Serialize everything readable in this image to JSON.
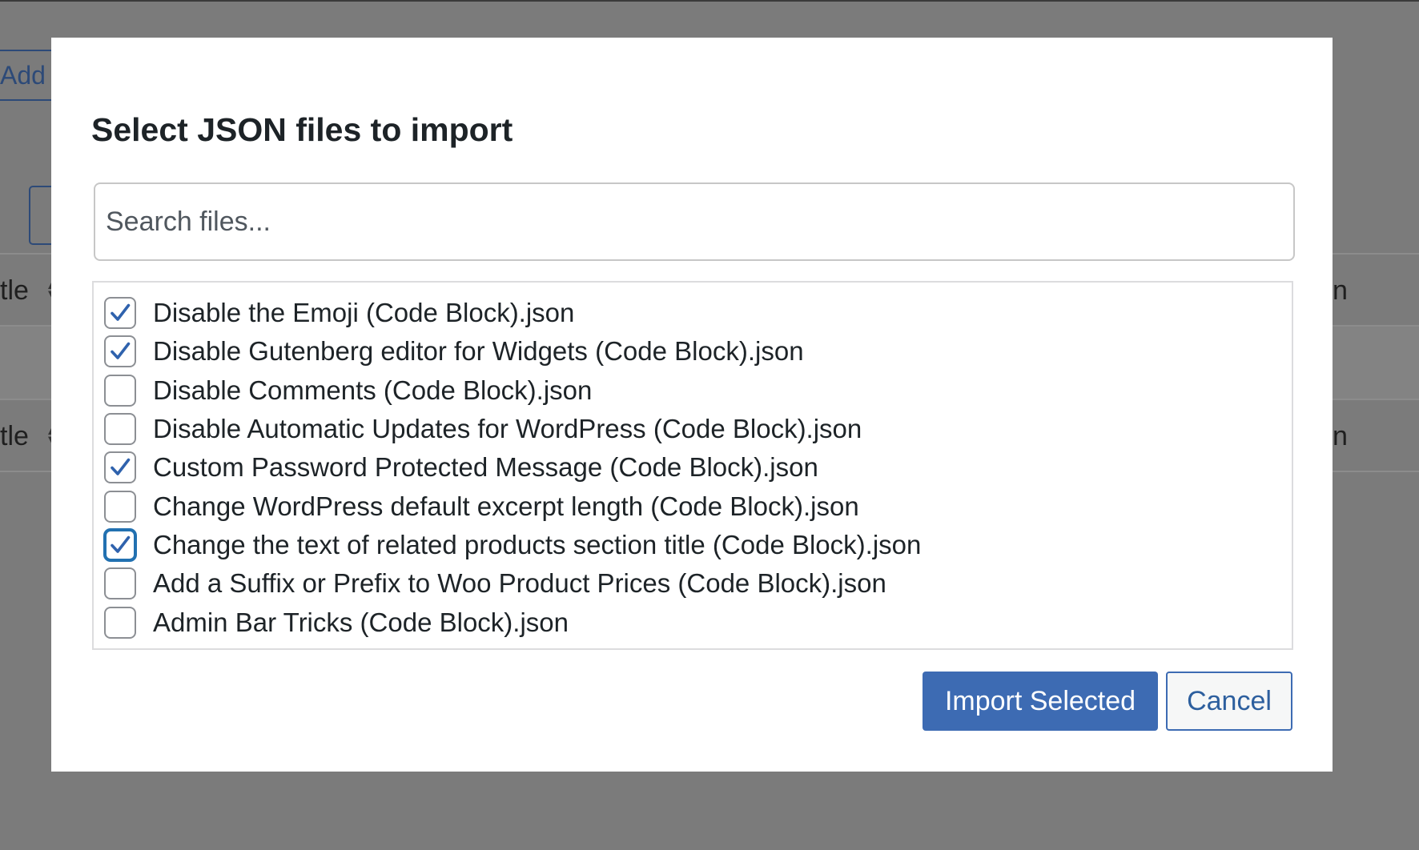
{
  "background": {
    "add_button_label": "Add",
    "column_title_label": "tle",
    "column_right_label": "n"
  },
  "modal": {
    "title": "Select JSON files to import",
    "search": {
      "placeholder": "Search files...",
      "value": ""
    },
    "files": [
      {
        "label": "Disable the Emoji (Code Block).json",
        "checked": true
      },
      {
        "label": "Disable Gutenberg editor for Widgets (Code Block).json",
        "checked": true
      },
      {
        "label": "Disable Comments (Code Block).json",
        "checked": false
      },
      {
        "label": "Disable Automatic Updates for WordPress (Code Block).json",
        "checked": false
      },
      {
        "label": "Custom Password Protected Message (Code Block).json",
        "checked": true
      },
      {
        "label": "Change WordPress default excerpt length (Code Block).json",
        "checked": false
      },
      {
        "label": "Change the text of related products section title (Code Block).json",
        "checked": true,
        "focused": true
      },
      {
        "label": "Add a Suffix or Prefix to Woo Product Prices (Code Block).json",
        "checked": false
      },
      {
        "label": "Admin Bar Tricks (Code Block).json",
        "checked": false
      }
    ],
    "import_button_label": "Import Selected",
    "cancel_button_label": "Cancel"
  },
  "icons": {
    "checkbox_check": "checkmark-icon",
    "sort": "sort-arrows-icon"
  },
  "colors": {
    "overlay": "#7b7b7b",
    "primary": "#3d6bb3",
    "check": "#2f62ad"
  }
}
